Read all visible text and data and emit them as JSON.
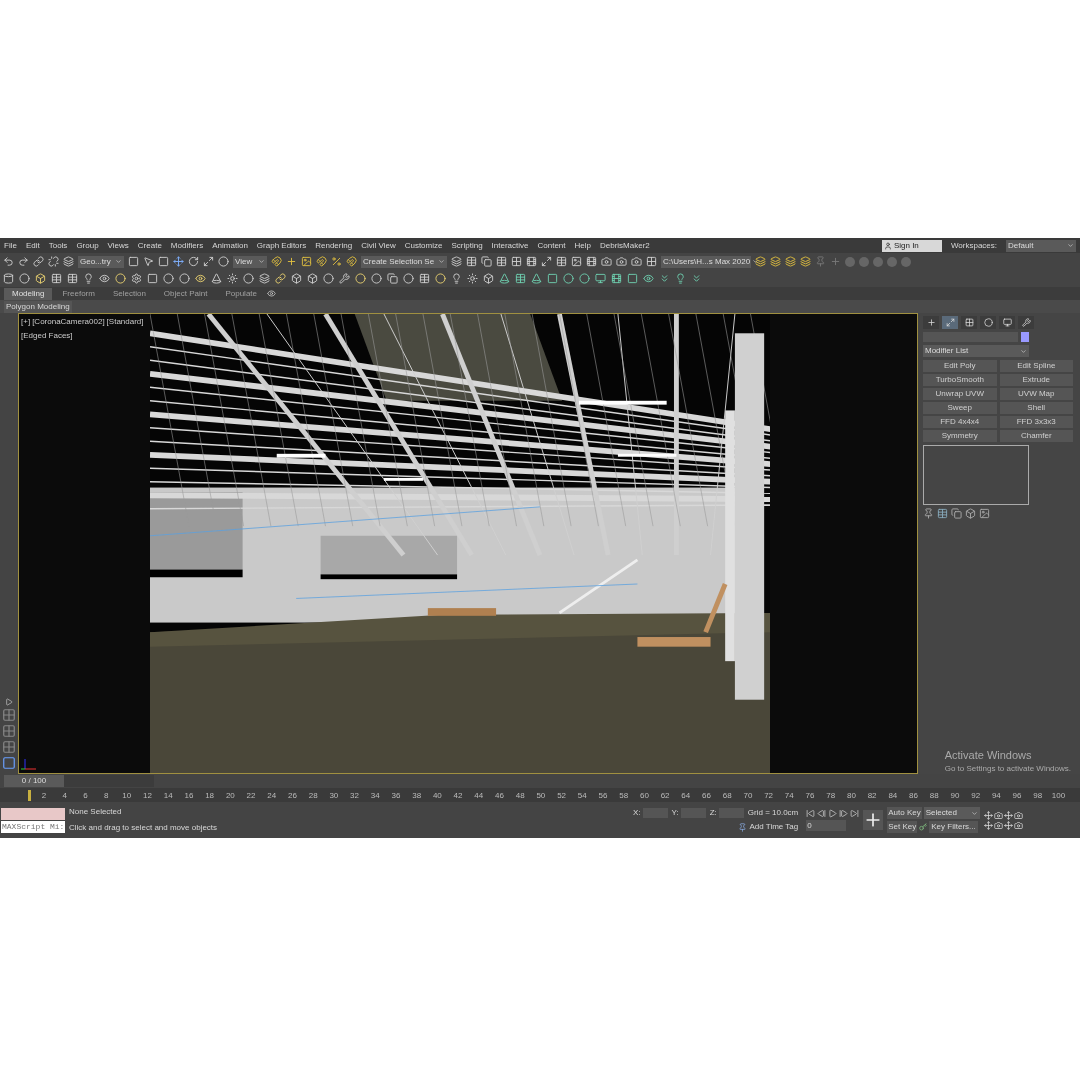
{
  "menu": [
    "File",
    "Edit",
    "Tools",
    "Group",
    "Views",
    "Create",
    "Modifiers",
    "Animation",
    "Graph Editors",
    "Rendering",
    "Civil View",
    "Customize",
    "Scripting",
    "Interactive",
    "Content",
    "Help",
    "DebrisMaker2"
  ],
  "account": {
    "sign_in": "Sign In",
    "workspaces_label": "Workspaces:",
    "workspace": "Default"
  },
  "toolbar": {
    "selection_filter": "Geo...try",
    "reference_coord": "View",
    "named_selection": "Create Selection Se",
    "project_path": "C:\\Users\\H...s Max 2020"
  },
  "ribbon": {
    "tabs": [
      {
        "label": "Modeling",
        "selected": true
      },
      {
        "label": "Freeform",
        "selected": false
      },
      {
        "label": "Selection",
        "selected": false
      },
      {
        "label": "Object Paint",
        "selected": false
      },
      {
        "label": "Populate",
        "selected": false
      }
    ],
    "panel": "Polygon Modeling"
  },
  "viewport": {
    "labels": [
      "[+]",
      "[CoronaCamera002]",
      "[Standard]",
      "[Edged Faces]"
    ]
  },
  "command_panel": {
    "tabs": [
      {
        "kind": "create",
        "selected": false
      },
      {
        "kind": "modify",
        "selected": true
      },
      {
        "kind": "hierarchy",
        "selected": false
      },
      {
        "kind": "motion",
        "selected": false
      },
      {
        "kind": "display",
        "selected": false
      },
      {
        "kind": "utilities",
        "selected": false
      }
    ],
    "modifier_list": "Modifier List",
    "modifier_buttons": [
      "Edit Poly",
      "Edit Spline",
      "TurboSmooth",
      "Extrude",
      "Unwrap UVW",
      "UVW Map",
      "Sweep",
      "Shell",
      "FFD 4x4x4",
      "FFD 3x3x3",
      "Symmetry",
      "Chamfer"
    ]
  },
  "timeline": {
    "position": "0 / 100",
    "level": 0,
    "ticks": [
      "2",
      "4",
      "6",
      "8",
      "10",
      "12",
      "14",
      "16",
      "18",
      "20",
      "22",
      "24",
      "26",
      "28",
      "30",
      "32",
      "34",
      "36",
      "38",
      "40",
      "42",
      "44",
      "46",
      "48",
      "50",
      "52",
      "54",
      "56",
      "58",
      "60",
      "62",
      "64",
      "66",
      "68",
      "70",
      "72",
      "74",
      "76",
      "78",
      "80",
      "82",
      "84",
      "86",
      "88",
      "90",
      "92",
      "94",
      "96",
      "98",
      "100"
    ]
  },
  "status": {
    "maxscript": "MAXScript Mi:",
    "selection": "None Selected",
    "prompt": "Click and drag to select and move objects",
    "coord_labels": [
      "X:",
      "Y:",
      "Z:"
    ],
    "grid": "Grid = 10.0cm",
    "time_tag": "Add Time Tag",
    "frame": "0",
    "auto_key": "Auto Key",
    "key_mode": "Selected",
    "set_key": "Set Key",
    "key_filters": "Key Filters..."
  },
  "activation": {
    "title": "Activate Windows",
    "message": "Go to Settings to activate Windows."
  }
}
